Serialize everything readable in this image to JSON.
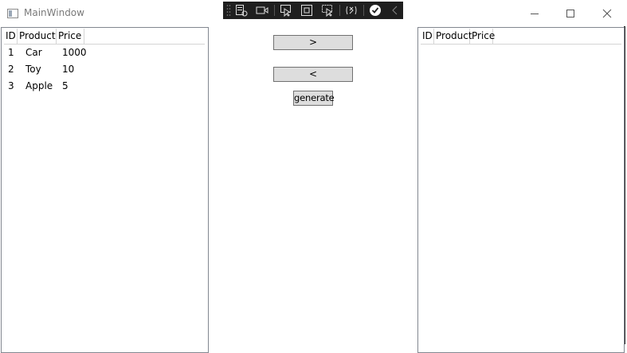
{
  "window": {
    "title": "MainWindow"
  },
  "left_grid": {
    "columns": [
      "ID",
      "Product",
      "Price"
    ],
    "rows": [
      {
        "id": "1",
        "product": "Car",
        "price": "1000"
      },
      {
        "id": "2",
        "product": "Toy",
        "price": "10"
      },
      {
        "id": "3",
        "product": "Apple",
        "price": "5"
      }
    ]
  },
  "right_grid": {
    "columns": [
      "ID",
      "Product",
      "Price"
    ],
    "rows": []
  },
  "buttons": {
    "move_right": ">",
    "move_left": "<",
    "generate": "generate"
  },
  "debug_toolbar": {
    "icons": [
      "grip-icon",
      "select-element-icon",
      "video-camera-icon",
      "cursor-select-icon",
      "display-layout-icon",
      "track-focus-icon",
      "hot-reload-icon",
      "check-circle-icon",
      "collapse-chevron-icon"
    ]
  }
}
